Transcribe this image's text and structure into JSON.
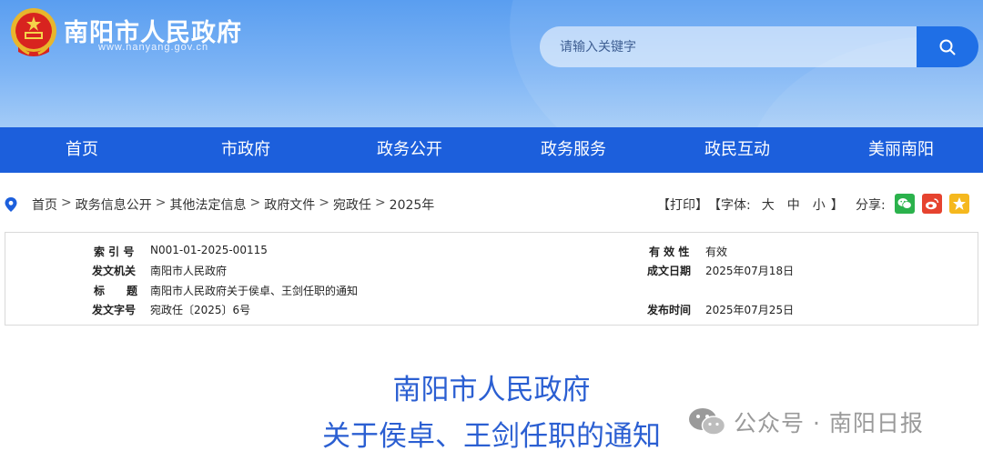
{
  "header": {
    "site_title": "南阳市人民政府",
    "site_url": "www.nanyang.gov.cn",
    "emblem_icon": "national-emblem-icon",
    "search_placeholder": "请输入关键字",
    "search_icon": "search-icon",
    "colors": {
      "banner": "#6aa6f2",
      "nav": "#1c5fdc",
      "search_button": "#1f6fe6"
    }
  },
  "nav": {
    "items": [
      {
        "label": "首页"
      },
      {
        "label": "市政府"
      },
      {
        "label": "政务公开"
      },
      {
        "label": "政务服务"
      },
      {
        "label": "政民互动"
      },
      {
        "label": "美丽南阳"
      }
    ]
  },
  "breadcrumb": {
    "icon": "location-pin-icon",
    "items": [
      "首页",
      "政务信息公开",
      "其他法定信息",
      "政府文件",
      "宛政任",
      "2025年"
    ],
    "separator": ">"
  },
  "tools": {
    "print": "【打印】",
    "font_prefix": "【字体:",
    "font_large": "大",
    "font_medium": "中",
    "font_small": "小",
    "font_suffix": "】",
    "share_label": "分享:",
    "share_icons": [
      "wechat-icon",
      "weibo-icon",
      "qzone-icon"
    ]
  },
  "info": {
    "index_label": "索 引 号",
    "index_value": "N001-01-2025-00115",
    "validity_label": "有 效 性",
    "validity_value": "有效",
    "issuer_label": "发文机关",
    "issuer_value": "南阳市人民政府",
    "date_label": "成文日期",
    "date_value": "2025年07月18日",
    "title_label": "标　　题",
    "title_value": "南阳市人民政府关于侯卓、王剑任职的通知",
    "docno_label": "发文字号",
    "docno_value": "宛政任〔2025〕6号",
    "publish_label": "发布时间",
    "publish_value": "2025年07月25日"
  },
  "document": {
    "title_line1": "南阳市人民政府",
    "title_line2": "关于侯卓、王剑任职的通知"
  },
  "watermark": {
    "icon": "wechat-icon",
    "text": "公众号 · 南阳日报"
  }
}
